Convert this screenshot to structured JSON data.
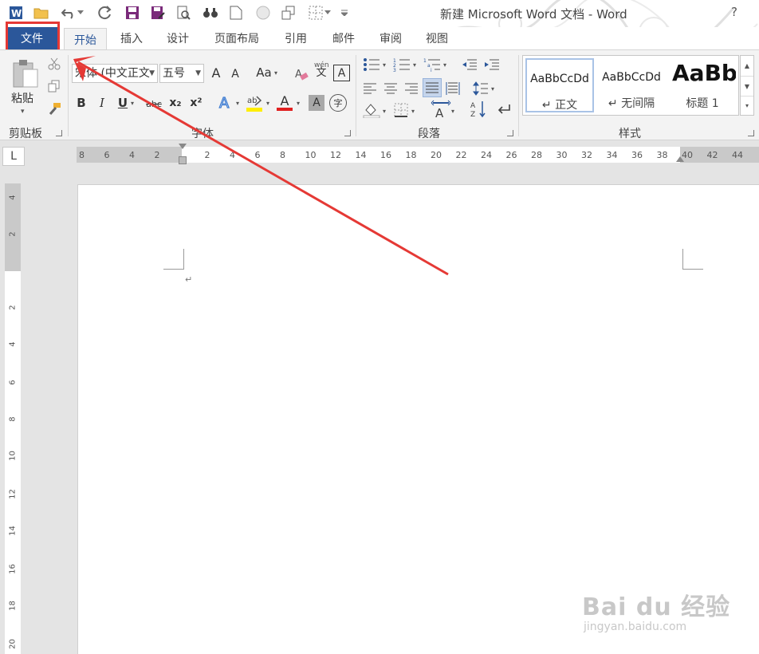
{
  "window": {
    "title": "新建 Microsoft Word 文档 - Word",
    "help": "?"
  },
  "tabs": {
    "file": "文件",
    "home": "开始",
    "insert": "插入",
    "design": "设计",
    "layout": "页面布局",
    "references": "引用",
    "mailings": "邮件",
    "review": "审阅",
    "view": "视图"
  },
  "clipboard": {
    "paste": "粘贴",
    "label": "剪贴板"
  },
  "font": {
    "name": "宋体 (中文正文",
    "size": "五号",
    "grow": "A",
    "shrink": "A",
    "case": "Aa",
    "bold": "B",
    "italic": "I",
    "underline": "U",
    "strike": "abc",
    "subscript": "x₂",
    "superscript": "x²",
    "wen": "wén",
    "wenzi": "文",
    "label": "字体",
    "char_border": "A",
    "char_shade": "A",
    "enclose": "字",
    "color": "A"
  },
  "paragraph": {
    "label": "段落"
  },
  "styles": {
    "label": "样式",
    "items": [
      {
        "sample": "AaBbCcDd",
        "name": "↵ 正文"
      },
      {
        "sample": "AaBbCcDd",
        "name": "↵ 无间隔"
      },
      {
        "sample": "AaBb",
        "name": "标题 1"
      }
    ]
  },
  "ruler": {
    "tab_selector": "L",
    "h_ticks": [
      "8",
      "6",
      "4",
      "2",
      "2",
      "4",
      "6",
      "8",
      "10",
      "12",
      "14",
      "16",
      "18",
      "20",
      "22",
      "24",
      "26",
      "28",
      "30",
      "32",
      "34",
      "36",
      "38",
      "40",
      "42",
      "44"
    ],
    "v_ticks": [
      "4",
      "2",
      "2",
      "4",
      "6",
      "8",
      "10",
      "12",
      "14",
      "16",
      "18",
      "20"
    ]
  },
  "document": {
    "paragraph_mark": "↵"
  },
  "watermark": {
    "main": "Bai du 经验",
    "sub": "jingyan.baidu.com"
  },
  "colors": {
    "accent": "#2b579a",
    "highlight": "#e53935",
    "font_color_bar": "#e02020",
    "highlight_bar": "#ffee00"
  }
}
